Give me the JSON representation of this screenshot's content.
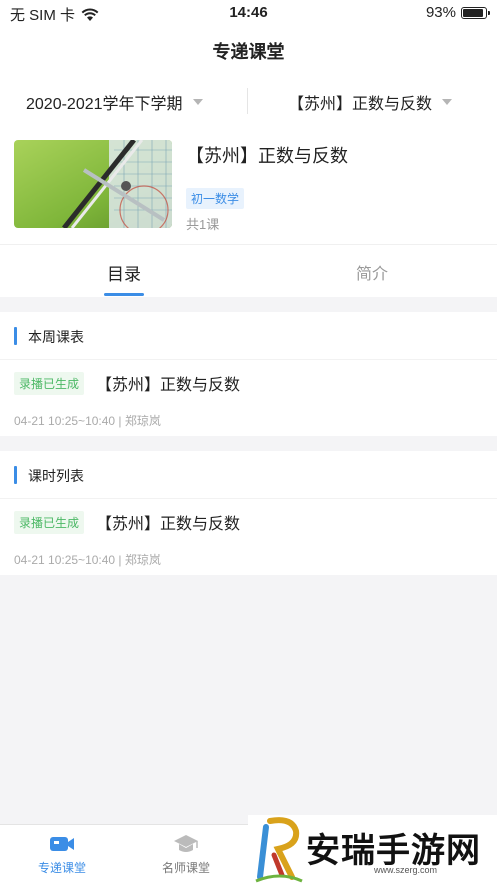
{
  "status_bar": {
    "carrier": "无 SIM 卡",
    "time": "14:46",
    "battery": "93%",
    "battery_level": 0.93
  },
  "nav": {
    "title": "专递课堂"
  },
  "filters": {
    "term": "2020-2021学年下学期",
    "course": "【苏州】正数与反数"
  },
  "course": {
    "title": "【苏州】正数与反数",
    "tag": "初一数学",
    "count": "共1课"
  },
  "tabs": [
    {
      "label": "目录",
      "active": true
    },
    {
      "label": "简介",
      "active": false
    }
  ],
  "sections": [
    {
      "title": "本周课表",
      "lessons": [
        {
          "badge": "录播已生成",
          "title": "【苏州】正数与反数",
          "meta": "04-21 10:25~10:40 | 郑琼岚"
        }
      ]
    },
    {
      "title": "课时列表",
      "lessons": [
        {
          "badge": "录播已生成",
          "title": "【苏州】正数与反数",
          "meta": "04-21 10:25~10:40 | 郑琼岚"
        }
      ]
    }
  ],
  "tab_bar": [
    {
      "label": "专递课堂",
      "icon": "video-camera-icon",
      "active": true
    },
    {
      "label": "名师课堂",
      "icon": "graduation-cap-icon",
      "active": false
    }
  ],
  "watermark": {
    "text": "安瑞手游网",
    "url": "www.szerg.com"
  },
  "colors": {
    "accent": "#3b8de6",
    "badge_green": "#4cb865",
    "background": "#f4f4f6"
  }
}
